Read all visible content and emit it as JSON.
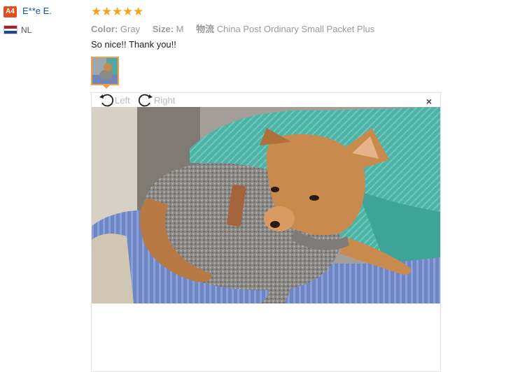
{
  "reviewer": {
    "avatar_badge": "A4",
    "name": "E**e E.",
    "country": "NL",
    "flag_colors": [
      "#ae1c28",
      "#ffffff",
      "#21468b"
    ]
  },
  "review": {
    "rating": 5,
    "rating_max": 5,
    "star_glyph": "★",
    "color_label": "Color:",
    "color_value": "Gray",
    "size_label": "Size:",
    "size_value": "M",
    "shipping_label": "物流",
    "shipping_value": "China Post Ordinary Small Packet Plus",
    "text": "So nice!! Thank you!!"
  },
  "viewer": {
    "rotate_left_label": "Left",
    "rotate_right_label": "Right",
    "close_glyph": "×"
  },
  "colors": {
    "accent": "#f39d4b",
    "star": "#f7a21b",
    "name_link": "#1a4fa3",
    "badge": "#e0501e"
  }
}
